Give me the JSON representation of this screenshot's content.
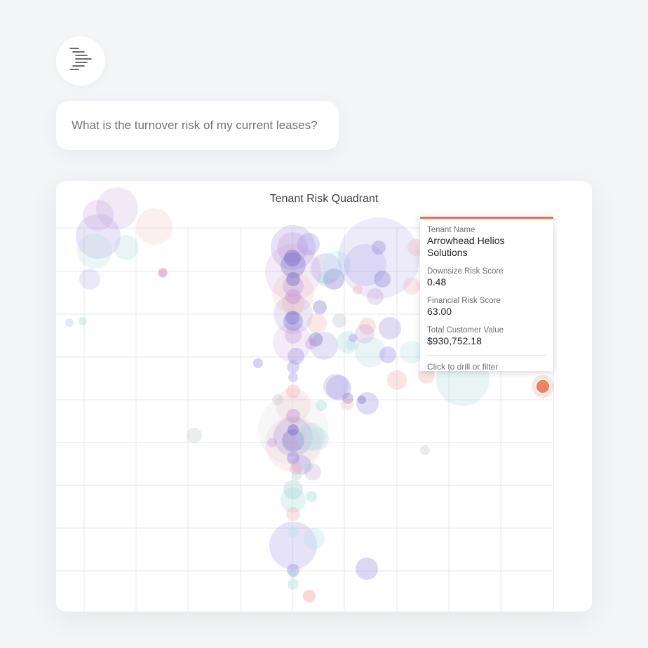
{
  "assistant": {
    "logo_icon": "bars-lines-icon"
  },
  "query": {
    "text": "What is the turnover risk of my current leases?"
  },
  "chart_data": {
    "type": "scatter",
    "title": "Tenant Risk Quadrant",
    "xlabel": "",
    "ylabel": "",
    "grid": true,
    "highlight_color": "#e8714f",
    "series_colors": [
      "#9a8ce0",
      "#c39ad8",
      "#f0b0b0",
      "#a9d8d6",
      "#7a70c8",
      "#b6e0ee",
      "#c8cacd"
    ]
  },
  "tooltip": {
    "name_label": "Tenant Name",
    "name_value": "Arrowhead Helios Solutions",
    "downsize_label": "Downsize Risk Score",
    "downsize_value": "0.48",
    "financial_label": "Financial Risk Score",
    "financial_value": "63.00",
    "tcv_label": "Total Customer Value",
    "tcv_value": "$930,752.18",
    "footer": "Click to drill or filter"
  }
}
